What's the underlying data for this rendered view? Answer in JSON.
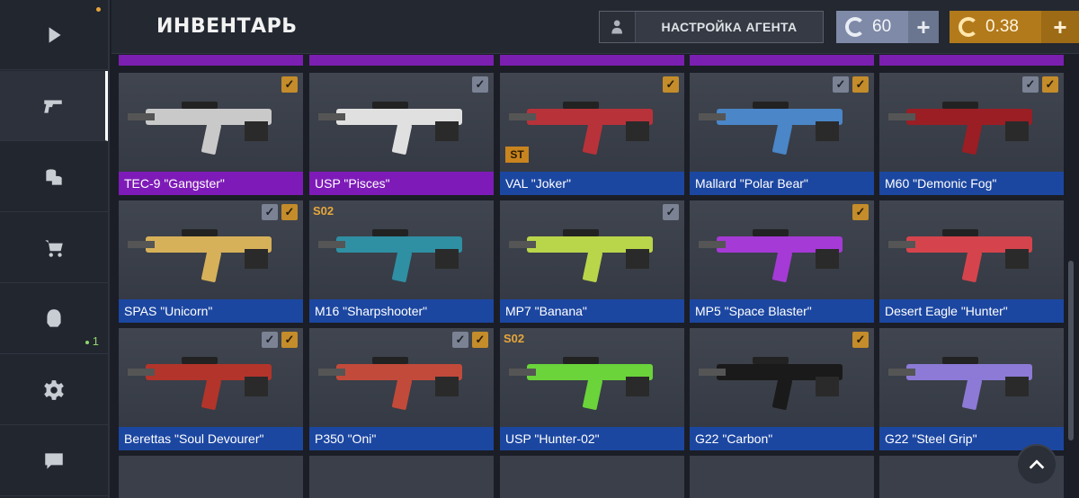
{
  "header": {
    "title": "ИНВЕНТАРЬ",
    "agent_button": "НАСТРОЙКА АГЕНТА",
    "silver_balance": "60",
    "gold_balance": "0.38",
    "plus": "+"
  },
  "sidebar": {
    "items": [
      {
        "icon": "play-icon"
      },
      {
        "icon": "pistol-icon",
        "active": true
      },
      {
        "icon": "coins-icon"
      },
      {
        "icon": "cart-icon"
      },
      {
        "icon": "agent-icon",
        "badge": "1"
      },
      {
        "icon": "gear-icon"
      },
      {
        "icon": "chat-icon"
      }
    ]
  },
  "cards": [
    {
      "name": "TEC-9 \"Gangster\"",
      "rarity": "purple",
      "checks": [
        "gold"
      ]
    },
    {
      "name": "USP \"Pisces\"",
      "rarity": "purple",
      "checks": [
        "silver"
      ]
    },
    {
      "name": "VAL \"Joker\"",
      "rarity": "blue",
      "checks": [
        "gold"
      ],
      "tag": "ST"
    },
    {
      "name": "Mallard \"Polar Bear\"",
      "rarity": "blue",
      "checks": [
        "silver",
        "gold"
      ]
    },
    {
      "name": "M60 \"Demonic Fog\"",
      "rarity": "blue",
      "checks": [
        "silver",
        "gold"
      ]
    },
    {
      "name": "SPAS \"Unicorn\"",
      "rarity": "blue",
      "checks": [
        "silver",
        "gold"
      ]
    },
    {
      "name": "M16 \"Sharpshooter\"",
      "rarity": "blue",
      "checks": [],
      "tag": "S02"
    },
    {
      "name": "MP7 \"Banana\"",
      "rarity": "blue",
      "checks": [
        "silver"
      ]
    },
    {
      "name": "MP5 \"Space Blaster\"",
      "rarity": "blue",
      "checks": [
        "gold"
      ]
    },
    {
      "name": "Desert Eagle \"Hunter\"",
      "rarity": "blue",
      "checks": []
    },
    {
      "name": "Berettas \"Soul Devourer\"",
      "rarity": "blue",
      "checks": [
        "silver",
        "gold"
      ]
    },
    {
      "name": "P350 \"Oni\"",
      "rarity": "blue",
      "checks": [
        "silver",
        "gold"
      ]
    },
    {
      "name": "USP \"Hunter-02\"",
      "rarity": "blue",
      "checks": [],
      "tag": "S02"
    },
    {
      "name": "G22 \"Carbon\"",
      "rarity": "blue",
      "checks": [
        "gold"
      ]
    },
    {
      "name": "G22 \"Steel Grip\"",
      "rarity": "blue",
      "checks": []
    }
  ],
  "check_glyph": "✓",
  "colors": {
    "purple": "#7e1bb8",
    "blue": "#1c47a1",
    "silver": "#7e8aa7",
    "gold": "#b27a1b"
  }
}
